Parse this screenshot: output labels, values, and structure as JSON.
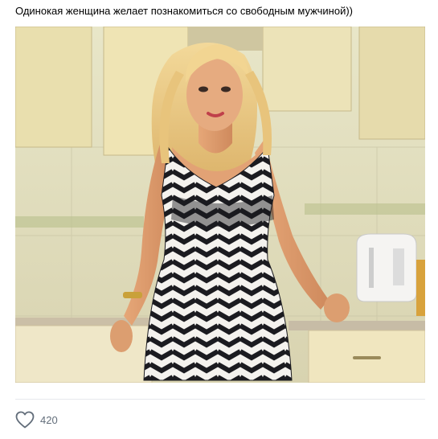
{
  "post": {
    "text": "Одинокая женщина желает познакомиться со свободным мужчиной))",
    "photo_icon": "photo-woman-in-kitchen",
    "likes": {
      "icon": "heart-outline-icon",
      "count": "420",
      "icon_color": "#626d7a"
    }
  },
  "colors": {
    "divider": "#e7e8ec",
    "text": "#000000",
    "meta_text": "#626d7a"
  }
}
